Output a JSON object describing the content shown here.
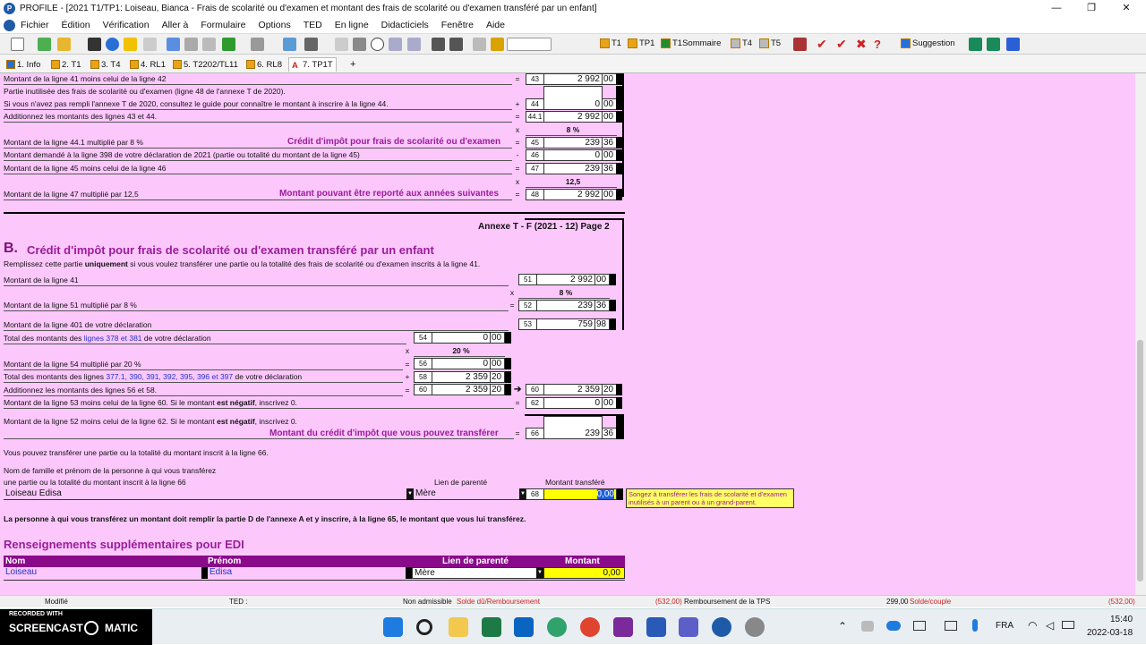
{
  "window": {
    "title": "PROFILE - [2021 T1/TP1: Loiseau, Bianca - Frais de scolarité ou d'examen et montant des frais de scolarité ou d'examen transféré par un enfant]",
    "minimize": "—",
    "maximize": "❐",
    "close": "✕"
  },
  "menu": [
    "Fichier",
    "Édition",
    "Vérification",
    "Aller à",
    "Formulaire",
    "Options",
    "TED",
    "En ligne",
    "Didacticiels",
    "Fenêtre",
    "Aide"
  ],
  "toolbar": {
    "t1": "T1",
    "tp1": "TP1",
    "t1sommaire": "T1Sommaire",
    "t4": "T4",
    "t5": "T5",
    "suggestion": "Suggestion"
  },
  "tabs": [
    "1. Info",
    "2. T1",
    "3. T4",
    "4. RL1",
    "5. T2202/TL11",
    "6. RL8",
    "7. TP1T",
    "+"
  ],
  "partA": {
    "l43_desc": "Montant de la ligne 41 moins celui de la ligne 42",
    "l44_desc1": "Partie inutilisée des frais de scolarité ou d'examen (ligne 48 de l'annexe T de 2020).",
    "l44_desc2": "Si vous n'avez pas rempli l'annexe T de 2020, consultez le guide pour connaître le montant à inscrire à la ligne 44.",
    "l441_desc": "Additionnez les montants des lignes 43 et 44.",
    "l45_desc": "Montant de la ligne 44.1 multiplié par 8 %",
    "l45_label": "Crédit d'impôt pour frais de scolarité ou d'examen",
    "l46_desc": "Montant demandé à la ligne 398 de votre déclaration de 2021 (partie ou totalité du montant de la ligne 45)",
    "l47_desc": "Montant de la ligne 45 moins celui de la ligne 46",
    "l48_desc": "Montant de la ligne 47 multiplié par 12,5",
    "l48_label": "Montant pouvant être reporté aux années suivantes",
    "pct8": "8 %",
    "mult125": "12,5",
    "x": "x",
    "ops": {
      "l43": "=",
      "l44": "+",
      "l441": "=",
      "l45": "=",
      "l46": "-",
      "l47": "=",
      "l48": "="
    },
    "lines": {
      "l43": "43",
      "l44": "44",
      "l441": "44.1",
      "l45": "45",
      "l46": "46",
      "l47": "47",
      "l48": "48"
    },
    "amounts": {
      "l43": "2 992",
      "l44": "0",
      "l441": "2 992",
      "l45": "239",
      "l46": "0",
      "l47": "239",
      "l48": "2 992"
    },
    "cents": {
      "l43": "00",
      "l44": "00",
      "l441": "00",
      "l45": "36",
      "l46": "00",
      "l47": "36",
      "l48": "00"
    }
  },
  "page_header": "Annexe T - F (2021 - 12)  Page 2",
  "partB": {
    "letter": "B.",
    "title": "Crédit d'impôt pour frais de scolarité ou d'examen transféré par un enfant",
    "intro_pre": "Remplissez cette partie ",
    "intro_bold": "uniquement",
    "intro_post": " si vous voulez transférer une partie ou la totalité des frais de scolarité ou d'examen inscrits à la ligne 41.",
    "l51_desc": "Montant de la ligne 41",
    "l52_desc": "Montant de la ligne 51 multiplié par 8 %",
    "l53_desc": "Montant de la ligne 401 de votre déclaration",
    "l54_pre": "Total des montants des ",
    "l54_link": "lignes 378 et 381",
    "l54_post": " de votre déclaration",
    "l56_desc": "Montant de la ligne 54 multiplié par 20 %",
    "l58_pre": "Total des montants des lignes ",
    "l58_link": "377.1, 390, 391, 392, 395, 396 et 397",
    "l58_post": " de votre déclaration",
    "l60_desc": "Additionnez les montants des lignes 56 et 58.",
    "l62_pre": "Montant de la ligne 53 moins celui de la ligne 60. Si le montant ",
    "l62_bold": "est négatif",
    "l62_post": ", inscrivez 0.",
    "l66_pre": "Montant de la ligne 52 moins celui de la ligne 62. Si le montant ",
    "l66_bold": "est négatif",
    "l66_post": ", inscrivez 0.",
    "l66_label": "Montant du crédit d'impôt que vous pouvez transférer",
    "pct8": "8 %",
    "pct20": "20 %",
    "x": "x",
    "ops": {
      "l52": "=",
      "l56": "=",
      "l58": "+",
      "l60a": "=",
      "l62": "=",
      "l66": "="
    },
    "lines": {
      "l51": "51",
      "l52": "52",
      "l53": "53",
      "l54": "54",
      "l56": "56",
      "l58": "58",
      "l60a": "60",
      "l60": "60",
      "l62": "62",
      "l66": "66",
      "l68": "68"
    },
    "amounts": {
      "l51": "2 992",
      "l52": "239",
      "l53": "759",
      "l54": "0",
      "l56": "0",
      "l58": "2 359",
      "l60a": "2 359",
      "l60": "2 359",
      "l62": "0",
      "l66": "239"
    },
    "cents": {
      "l51": "00",
      "l52": "36",
      "l53": "98",
      "l54": "00",
      "l56": "00",
      "l58": "20",
      "l60a": "20",
      "l60": "20",
      "l62": "00",
      "l66": "36"
    },
    "transfer_note": "Vous pouvez transférer une partie ou la totalité du montant inscrit à la ligne 66.",
    "name_label1": "Nom de famille et prénom de la personne à qui vous transférez",
    "name_label2": "une partie ou la totalité du montant inscrit à la ligne 66",
    "relation_label": "Lien de parenté",
    "amount_label": "Montant transféré",
    "name_value": "Loiseau Edisa",
    "relation_value": "Mère",
    "transfer_amount": "0,00",
    "tooltip": "Songez à transférer les frais de scolarité et d'examen inutilisés à un parent ou à un grand-parent.",
    "footer_note": "La personne à qui vous transférez un montant doit remplir la partie D de l'annexe A et y inscrire, à la ligne 65, le montant que vous lui transférez."
  },
  "edi": {
    "title": "Renseignements supplémentaires pour EDI",
    "headers": [
      "Nom",
      "Prénom",
      "Lien de parenté",
      "Montant"
    ],
    "row": {
      "nom": "Loiseau",
      "prenom": "Edisa",
      "lien": "Mère",
      "montant": "0,00"
    }
  },
  "status": {
    "modifie": "Modifié",
    "ted": "TED :",
    "non_admissible": "Non admissible",
    "solde_du": "Solde dû/Remboursement",
    "solde_val": "(532,00)",
    "tps": "Remboursement de la TPS",
    "tps_val": "299,00",
    "solde_couple": "Solde/couple",
    "couple_val": "(532,00)"
  },
  "taskbar": {
    "recorded": "RECORDED WITH",
    "screencast": "SCREENCAST",
    "matic": "MATIC",
    "lang": "FRA",
    "time": "15:40",
    "date": "2022-03-18"
  },
  "colors": {
    "form_bg": "#fcc8fc",
    "accent": "#9b1c9b",
    "edi_header": "#8a0b8a",
    "field_yellow": "#ffff00"
  }
}
